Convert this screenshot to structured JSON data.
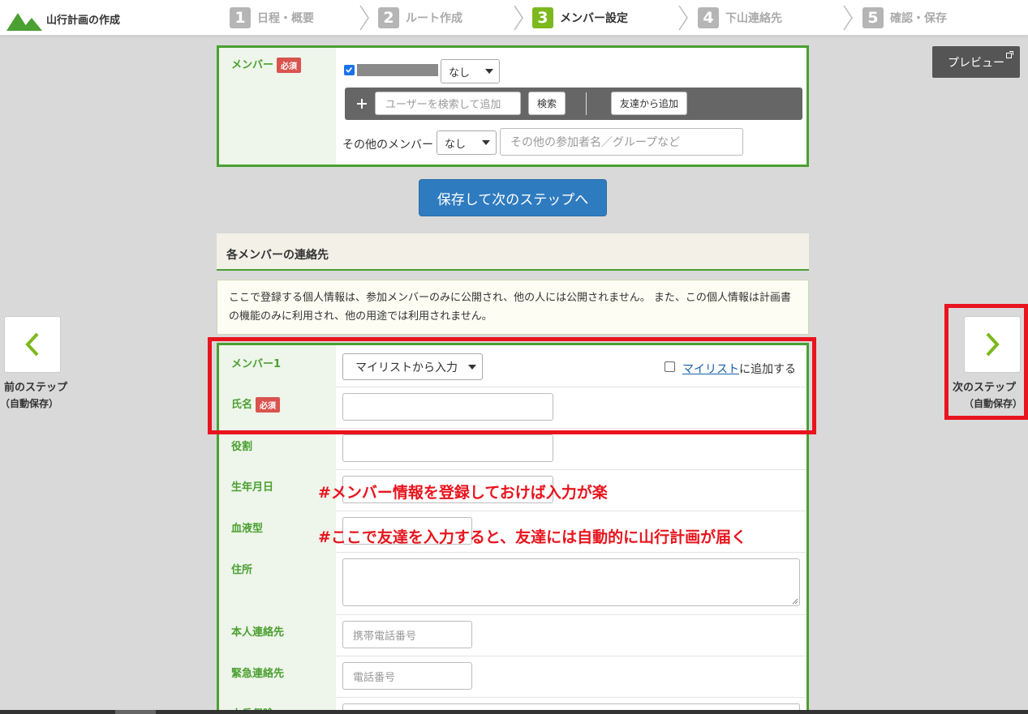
{
  "app_title": "山行計画の作成",
  "steps": [
    {
      "num": "1",
      "label": "日程・概要"
    },
    {
      "num": "2",
      "label": "ルート作成"
    },
    {
      "num": "3",
      "label": "メンバー設定"
    },
    {
      "num": "4",
      "label": "下山連絡先"
    },
    {
      "num": "5",
      "label": "確認・保存"
    }
  ],
  "active_step": 3,
  "preview_label": "プレビュー",
  "members": {
    "label": "メンバー",
    "required": "必須",
    "role_select": "なし",
    "search_placeholder": "ユーザーを検索して追加",
    "search_button": "検索",
    "friend_button": "友達から追加",
    "other_label": "その他のメンバー",
    "other_select": "なし",
    "other_placeholder": "その他の参加者名／グループなど"
  },
  "save_next": "保存して次のステップへ",
  "contacts": {
    "heading": "各メンバーの連絡先",
    "notice": "ここで登録する個人情報は、参加メンバーのみに公開され、他の人には公開されません。 また、この個人情報は計画書の機能のみに利用され、他の用途では利用されません。",
    "member1_label": "メンバー1",
    "mylist_select": "マイリストから入力",
    "mylist_link": "マイリスト",
    "mylist_suffix": "に追加する",
    "name_label": "氏名",
    "required": "必須",
    "role_label": "役割",
    "birthday_label": "生年月日",
    "blood_label": "血液型",
    "address_label": "住所",
    "self_contact_label": "本人連絡先",
    "self_contact_placeholder": "携帯電話番号",
    "emergency_label": "緊急連絡先",
    "emergency_placeholder": "電話番号",
    "insurance_label": "山岳保険"
  },
  "annotations": [
    "#メンバー情報を登録しておけば入力が楽",
    "#ここで友達を入力すると、友達には自動的に山行計画が届く"
  ],
  "prev_step": {
    "label": "前のステップ",
    "sub": "（自動保存）"
  },
  "next_step": {
    "label": "次のステップ",
    "sub": "（自動保存）"
  },
  "colors": {
    "brand_green": "#4aa031",
    "step_active": "#7cb81e",
    "primary_button": "#2f7bbf",
    "highlight_red": "#e8141e"
  }
}
